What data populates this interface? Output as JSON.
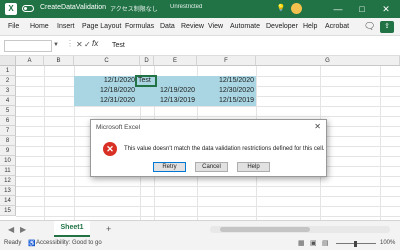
{
  "window": {
    "app_icon": "X",
    "filename": "CreateDataValidation",
    "status": "アクセス制限なし",
    "saved": "Unrestricted",
    "min": "—",
    "max": "□",
    "close": "✕",
    "lightbulb": "💡"
  },
  "menu": {
    "items": [
      "File",
      "Home",
      "Insert",
      "Page Layout",
      "Formulas",
      "Data",
      "Review",
      "View",
      "Automate",
      "Developer",
      "Help",
      "Acrobat"
    ],
    "comment_icon": "comment-icon",
    "share_icon": "share-icon"
  },
  "formula_bar": {
    "cancel": "✕",
    "enter": "✓",
    "fx": "fx",
    "value": "Test"
  },
  "grid": {
    "columns": [
      "A",
      "B",
      "C",
      "D",
      "E",
      "F",
      "G"
    ],
    "rows": [
      "1",
      "2",
      "3",
      "4",
      "5",
      "6",
      "7",
      "8",
      "9",
      "10",
      "11",
      "12",
      "13",
      "14",
      "15"
    ],
    "cells": {
      "c2": "12/1/2020",
      "d2": "Test",
      "f2": "12/15/2020",
      "c3": "12/18/2020",
      "e3": "12/19/2020",
      "f3": "12/30/2020",
      "c4": "12/31/2020",
      "e4": "12/13/2019",
      "f4": "12/15/2019"
    }
  },
  "dialog": {
    "title": "Microsoft Excel",
    "close": "✕",
    "icon": "error-icon",
    "message": "This value doesn't match the data validation restrictions defined for this cell.",
    "buttons": [
      "Retry",
      "Cancel",
      "Help"
    ]
  },
  "sheet_tabs": {
    "prev": "◀",
    "next": "▶",
    "active": "Sheet1",
    "add": "+"
  },
  "status_bar": {
    "ready": "Ready",
    "accessibility": "Accessibility: Good to go",
    "zoom": "100%"
  },
  "colors": {
    "brand": "#217346",
    "highlight": "#a9d6e2",
    "error": "#d93025"
  }
}
